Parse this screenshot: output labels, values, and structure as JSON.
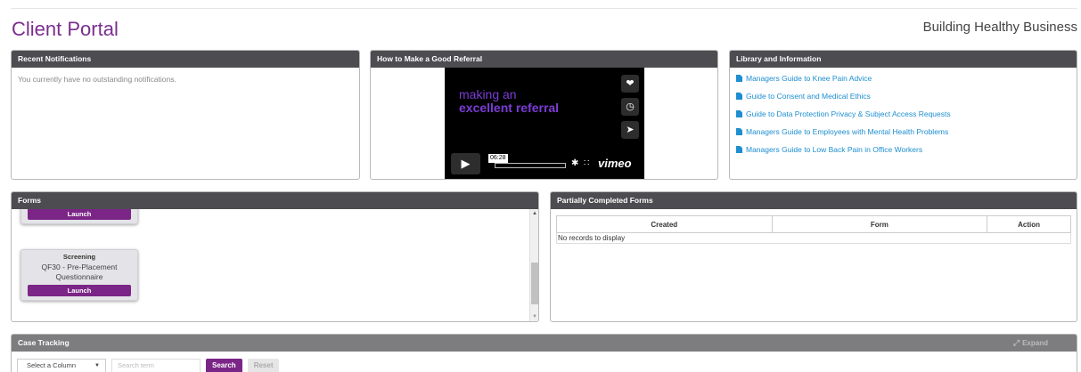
{
  "header": {
    "title": "Client Portal",
    "tagline": "Building Healthy Business"
  },
  "notifications": {
    "heading": "Recent Notifications",
    "message": "You currently have no outstanding notifications."
  },
  "referral": {
    "heading": "How to Make a Good Referral",
    "video_line1": "making an",
    "video_line2": "excellent referral",
    "time": "06:28",
    "logo": "vimeo"
  },
  "library": {
    "heading": "Library and Information",
    "items": [
      "Managers Guide to Knee Pain Advice",
      "Guide to Consent and Medical Ethics",
      "Guide to Data Protection Privacy & Subject Access Requests",
      "Managers Guide to Employees with Mental Health Problems",
      "Managers Guide to Low Back Pain in Office Workers"
    ]
  },
  "forms": {
    "heading": "Forms",
    "cards": [
      {
        "category": "",
        "description": "",
        "button": "Launch"
      },
      {
        "category": "Screening",
        "description": "QF30 - Pre-Placement Questionnaire",
        "button": "Launch"
      }
    ]
  },
  "partial": {
    "heading": "Partially Completed Forms",
    "columns": [
      "Created",
      "Form",
      "Action"
    ],
    "empty": "No records to display"
  },
  "case_tracking": {
    "heading": "Case Tracking",
    "expand": "Expand",
    "select_placeholder": "Select a Column",
    "search_placeholder": "Search term",
    "search_button": "Search",
    "reset_button": "Reset"
  },
  "colors": {
    "brand": "#7b2d8e",
    "panel_header": "#4d4d51",
    "link": "#1d8ed0"
  }
}
